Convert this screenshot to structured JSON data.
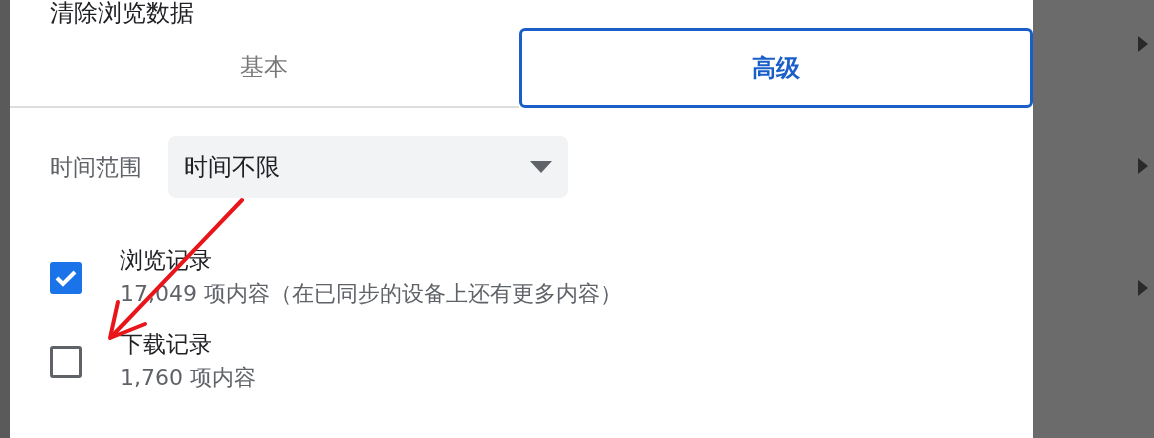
{
  "dialog": {
    "title": "清除浏览数据",
    "tabs": [
      {
        "label": "基本",
        "selected": false
      },
      {
        "label": "高级",
        "selected": true
      }
    ],
    "time_range": {
      "label": "时间范围",
      "value": "时间不限"
    },
    "items": [
      {
        "title": "浏览记录",
        "detail": "17,049 项内容（在已同步的设备上还有更多内容）",
        "checked": true
      },
      {
        "title": "下载记录",
        "detail": "1,760 项内容",
        "checked": false
      }
    ]
  }
}
